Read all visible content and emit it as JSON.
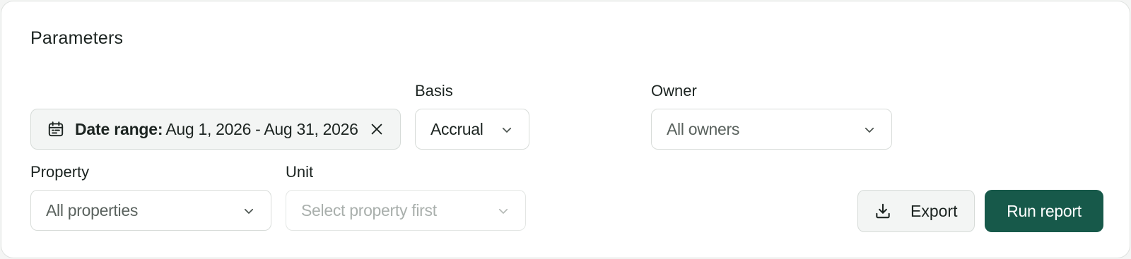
{
  "panel": {
    "title": "Parameters"
  },
  "date_range": {
    "label": "Date range:",
    "value": "Aug 1, 2026 - Aug 31, 2026",
    "icon": "calendar-icon",
    "clear_icon": "close-icon"
  },
  "basis": {
    "label": "Basis",
    "value": "Accrual"
  },
  "owner": {
    "label": "Owner",
    "value": "All owners"
  },
  "property": {
    "label": "Property",
    "value": "All properties"
  },
  "unit": {
    "label": "Unit",
    "placeholder": "Select property first",
    "disabled": true
  },
  "actions": {
    "export_label": "Export",
    "export_icon": "download-icon",
    "run_label": "Run report"
  },
  "colors": {
    "primary": "#17594a",
    "surface": "#ffffff",
    "chip_bg": "#f3f5f4",
    "border": "#d8dcd9",
    "muted_text": "#5a625e",
    "disabled_text": "#a9afac"
  }
}
